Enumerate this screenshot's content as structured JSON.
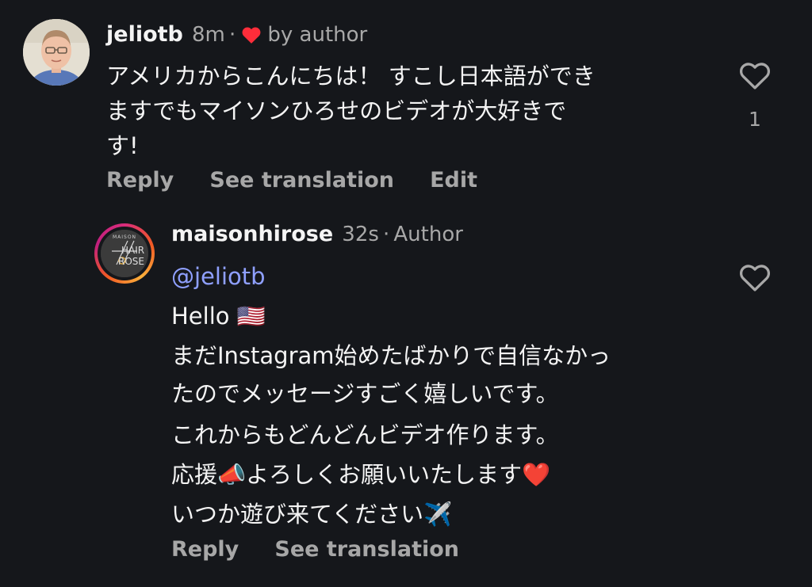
{
  "comment1": {
    "username": "jeliotb",
    "time": "8m",
    "separator": "·",
    "liked_by": "by author",
    "lines": [
      "アメリカからこんにちは！ すこし日本語ができ",
      "ますでもマイソンひろせのビデオが大好きで",
      "す!"
    ],
    "like_count": "1",
    "actions": {
      "reply": "Reply",
      "translate": "See translation",
      "edit": "Edit"
    }
  },
  "comment2": {
    "username": "maisonhirose",
    "time": "32s",
    "separator": "·",
    "badge": "Author",
    "avatar_text": {
      "top": "MAISON",
      "mid": "HAIR",
      "bottom": "ROSE"
    },
    "mention": "@jeliotb",
    "lines": [
      "Hello 🇺🇸",
      "まだInstagram始めたばかりで自信なかっ",
      "たのでメッセージすごく嬉しいです。",
      "これからもどんどんビデオ作ります。",
      "応援📣よろしくお願いいたします❤️",
      "いつか遊び来てください✈️"
    ],
    "actions": {
      "reply": "Reply",
      "translate": "See translation"
    }
  },
  "colors": {
    "background": "#15171b",
    "mention": "#8fa0ff",
    "heart_red": "#ff2d3a",
    "muted": "#a8a8a8"
  }
}
